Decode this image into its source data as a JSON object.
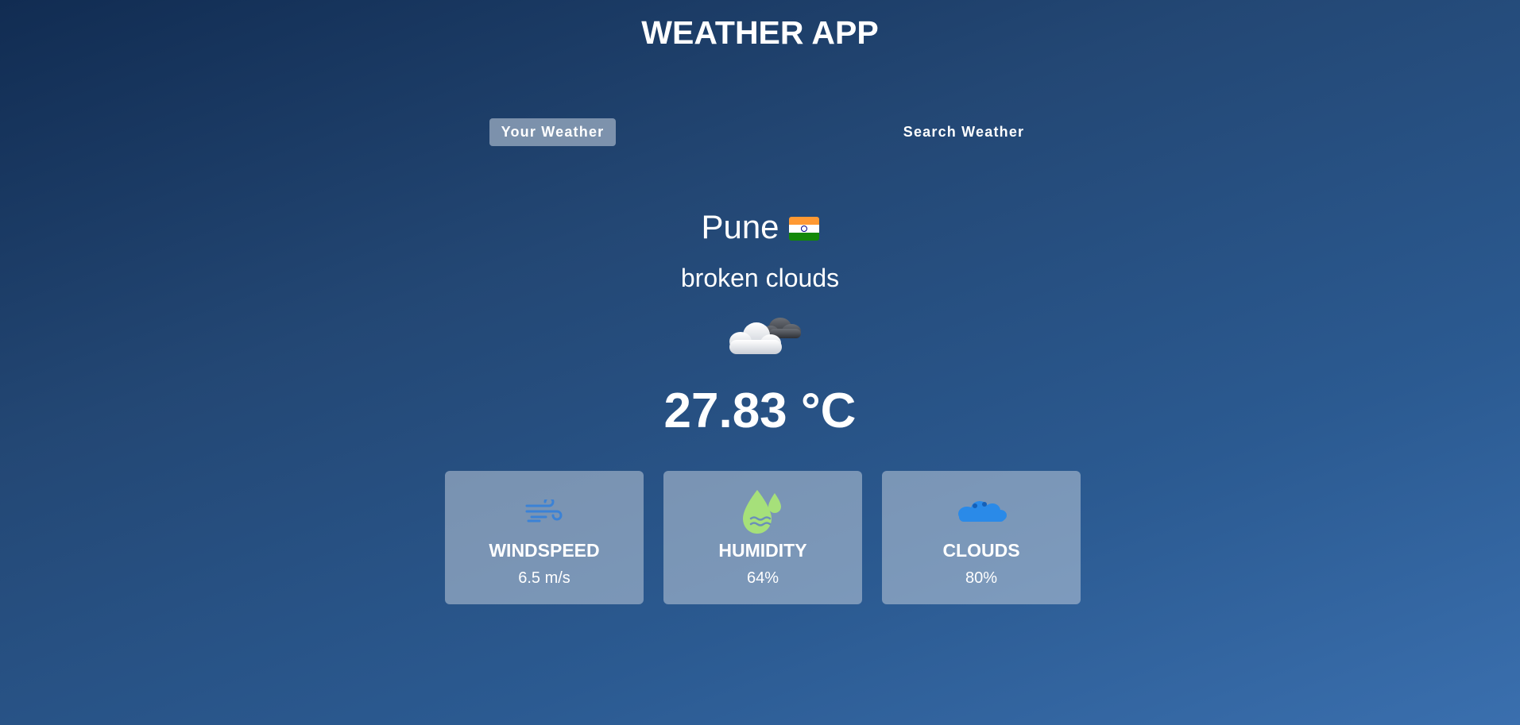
{
  "app": {
    "title": "WEATHER APP"
  },
  "tabs": [
    {
      "label": "Your Weather",
      "active": true
    },
    {
      "label": "Search Weather",
      "active": false
    }
  ],
  "location": {
    "city": "Pune",
    "country_flag_icon": "india-flag-icon"
  },
  "weather": {
    "description": "broken clouds",
    "icon": "broken-clouds-icon",
    "temperature": "27.83 °C"
  },
  "stats": [
    {
      "label": "WINDSPEED",
      "value": "6.5 m/s",
      "icon": "wind-icon"
    },
    {
      "label": "HUMIDITY",
      "value": "64%",
      "icon": "humidity-icon"
    },
    {
      "label": "CLOUDS",
      "value": "80%",
      "icon": "cloud-icon"
    }
  ],
  "colors": {
    "background_top": "#112c52",
    "background_bottom": "#3a6fae",
    "card_bg": "#8a9fbe",
    "wind_icon": "#3b82d6",
    "humidity_icon": "#a6e07a",
    "cloud_icon": "#2a8ae8"
  }
}
